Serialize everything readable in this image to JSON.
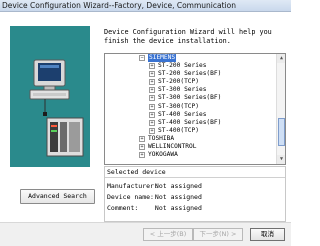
{
  "window": {
    "title": "Device Configuration Wizard--Factory, Device, Communication"
  },
  "intro": {
    "text": "Device Configuration Wizard will help you\nfinish the device installation."
  },
  "tree": {
    "items": [
      {
        "label": "SIEMENS",
        "expander": "⊟",
        "selected": true,
        "depth": 0
      },
      {
        "label": "ST-200 Series",
        "expander": "⊞",
        "selected": false,
        "depth": 1
      },
      {
        "label": "ST-200 Series(BF)",
        "expander": "⊞",
        "selected": false,
        "depth": 1
      },
      {
        "label": "ST-200(TCP)",
        "expander": "⊞",
        "selected": false,
        "depth": 1
      },
      {
        "label": "ST-300 Series",
        "expander": "⊞",
        "selected": false,
        "depth": 1
      },
      {
        "label": "ST-300 Series(BF)",
        "expander": "⊞",
        "selected": false,
        "depth": 1
      },
      {
        "label": "ST-300(TCP)",
        "expander": "⊞",
        "selected": false,
        "depth": 1
      },
      {
        "label": "ST-400 Series",
        "expander": "⊞",
        "selected": false,
        "depth": 1
      },
      {
        "label": "ST-400 Series(BF)",
        "expander": "⊞",
        "selected": false,
        "depth": 1
      },
      {
        "label": "ST-400(TCP)",
        "expander": "⊞",
        "selected": false,
        "depth": 1
      },
      {
        "label": "TOSHIBA",
        "expander": "⊞",
        "selected": false,
        "depth": 0
      },
      {
        "label": "WELLINCONTROL",
        "expander": "⊞",
        "selected": false,
        "depth": 0
      },
      {
        "label": "YOKOGAWA",
        "expander": "⊞",
        "selected": false,
        "depth": 0
      }
    ]
  },
  "selected_device": {
    "legend": "Selected device",
    "manufacturer_label": "Manufacturer:",
    "manufacturer_value": "Not assigned",
    "device_name_label": "Device name:",
    "device_name_value": "Not assigned",
    "comment_label": "Comment:",
    "comment_value": "Not assigned"
  },
  "buttons": {
    "advanced_search": "Advanced Search",
    "back": "< 上一步(B)",
    "next": "下一步(N) >",
    "cancel": "取消"
  }
}
